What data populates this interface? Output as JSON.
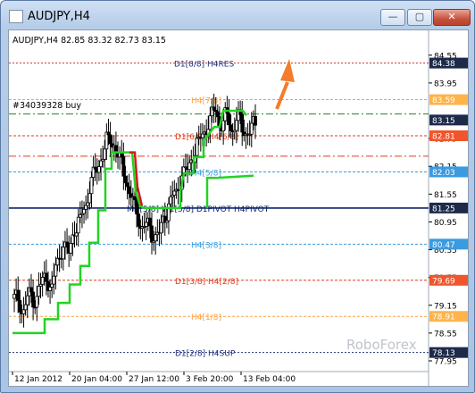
{
  "window": {
    "title": "AUDJPY,H4",
    "minimize_glyph": "—",
    "maximize_glyph": "▢",
    "close_glyph": "✕"
  },
  "chart_info": {
    "header": "AUDJPY,H4  82.85 83.32 82.73 83.15",
    "order_label": "#34039328 buy",
    "watermark": "RoboForex"
  },
  "chart_data": {
    "type": "candlestick",
    "symbol": "AUDJPY",
    "timeframe": "H4",
    "ohlc_last": {
      "open": 82.85,
      "high": 83.32,
      "low": 82.73,
      "close": 83.15
    },
    "ylim": [
      78.0,
      84.7
    ],
    "y_ticks": [
      84.55,
      83.95,
      82.75,
      82.15,
      81.55,
      80.95,
      80.35,
      79.75,
      79.15,
      78.55,
      77.95
    ],
    "x_ticks": [
      "12 Jan 2012",
      "20 Jan 04:00",
      "27 Jan 12:00",
      "3 Feb 20:00",
      "13 Feb 04:00"
    ],
    "price_tags": [
      {
        "value": 84.38,
        "color": "#ffffff",
        "bg": "#1d2a4a"
      },
      {
        "value": 83.59,
        "color": "#ffffff",
        "bg": "#ffb44a"
      },
      {
        "value": 83.15,
        "color": "#ffffff",
        "bg": "#1d2a4a"
      },
      {
        "value": 82.81,
        "color": "#ffffff",
        "bg": "#f0552c"
      },
      {
        "value": 82.03,
        "color": "#ffffff",
        "bg": "#3a9be0"
      },
      {
        "value": 81.25,
        "color": "#ffffff",
        "bg": "#1d2a4a"
      },
      {
        "value": 80.47,
        "color": "#ffffff",
        "bg": "#3a9be0"
      },
      {
        "value": 79.69,
        "color": "#ffffff",
        "bg": "#f0552c"
      },
      {
        "value": 78.91,
        "color": "#ffffff",
        "bg": "#ffb44a"
      },
      {
        "value": 78.13,
        "color": "#ffffff",
        "bg": "#1d2a4a"
      }
    ],
    "levels": [
      {
        "value": 84.38,
        "label": "D1[8/8] H4RES",
        "color": "#c9302a",
        "dash": "2,2",
        "label_color": "#1c2f7a"
      },
      {
        "value": 83.59,
        "label": "H4[7/8]",
        "color": "#ffa040",
        "dash": "3,2",
        "label_color": "#ffa040"
      },
      {
        "value": 82.81,
        "label": "D1[6/8] H4[6/8]",
        "color": "#e23b1b",
        "dash": "3,2",
        "label_color": "#e23b1b"
      },
      {
        "value": 82.03,
        "label": "H4[5/8]",
        "color": "#3a9be0",
        "dash": "3,2",
        "label_color": "#3a9be0"
      },
      {
        "value": 81.25,
        "label": "MN[5/8] W1[5/8] D1PIVOT H4PIVOT",
        "color": "#10246b",
        "dash": "",
        "label_color": "#10246b"
      },
      {
        "value": 80.47,
        "label": "H4[3/8]",
        "color": "#3a9be0",
        "dash": "3,2",
        "label_color": "#3a9be0"
      },
      {
        "value": 79.69,
        "label": "D1[3/8] H4[2/8]",
        "color": "#e23b1b",
        "dash": "3,2",
        "label_color": "#e23b1b"
      },
      {
        "value": 78.91,
        "label": "H4[1/8]",
        "color": "#ffa040",
        "dash": "3,2",
        "label_color": "#ffa040"
      },
      {
        "value": 78.13,
        "label": "D1[2/8] H4SUP",
        "color": "#1c2f7a",
        "dash": "2,2",
        "label_color": "#1c2f7a"
      }
    ],
    "order_line": {
      "value": 83.28,
      "color": "#1a8a1a",
      "dash": "8,3,2,3"
    },
    "extra_line": {
      "value": 82.37,
      "color": "#e23b1b",
      "dash": "8,3,2,3"
    },
    "stop_line_green": [
      [
        78.55,
        78.55,
        79.0,
        79.5,
        80.0,
        80.5,
        81.0,
        81.6,
        81.6,
        82.4,
        82.4
      ],
      [
        0,
        26,
        37,
        46,
        60,
        78,
        88,
        96,
        114,
        114,
        124
      ]
    ],
    "close_path": [
      79.3,
      79.0,
      79.4,
      79.2,
      79.6,
      79.8,
      79.5,
      80.1,
      80.4,
      80.3,
      80.8,
      81.0,
      81.3,
      81.8,
      82.1,
      82.4,
      82.8,
      82.6,
      82.3,
      81.9,
      81.5,
      81.2,
      80.8,
      80.9,
      80.6,
      80.7,
      81.1,
      81.4,
      81.6,
      81.9,
      82.1,
      82.4,
      82.7,
      82.9,
      83.1,
      83.4,
      83.0,
      83.3,
      82.9,
      83.2,
      82.9,
      82.85,
      83.15
    ],
    "arrow": {
      "from": [
        300,
        108
      ],
      "to": [
        314,
        62
      ],
      "color": "#f47c2a"
    }
  }
}
